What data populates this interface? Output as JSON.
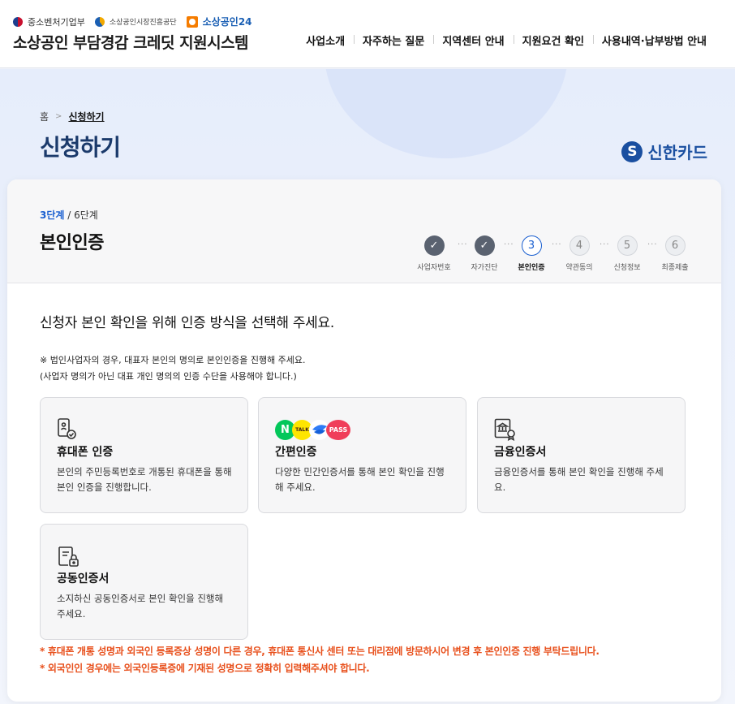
{
  "header": {
    "logo_ministry": "중소벤처기업부",
    "logo_agency": "소상공인시장진흥공단",
    "logo_portal": "소상공인24",
    "site_title": "소상공인 부담경감 크레딧 지원시스템",
    "nav": [
      "사업소개",
      "자주하는 질문",
      "지역센터 안내",
      "지원요건 확인",
      "사용내역·납부방법 안내"
    ]
  },
  "breadcrumb": {
    "home": "홈",
    "current": "신청하기"
  },
  "page_title": "신청하기",
  "partner": {
    "mark": "S",
    "name": "신한카드"
  },
  "step_header": {
    "current": "3단계",
    "total": " / 6단계",
    "title": "본인인증",
    "steps": [
      {
        "num": "✓",
        "label": "사업자번호",
        "state": "done"
      },
      {
        "num": "✓",
        "label": "자가진단",
        "state": "done"
      },
      {
        "num": "3",
        "label": "본인인증",
        "state": "active"
      },
      {
        "num": "4",
        "label": "약관동의",
        "state": "todo"
      },
      {
        "num": "5",
        "label": "신청정보",
        "state": "todo"
      },
      {
        "num": "6",
        "label": "최종제출",
        "state": "todo"
      }
    ]
  },
  "instruction": "신청자 본인 확인을 위해 인증 방식을 선택해 주세요.",
  "note_line1": "※ 법인사업자의 경우, 대표자 본인의 명의로 본인인증을 진행해 주세요.",
  "note_line2": "(사업자 명의가 아닌 대표 개인 명의의 인증 수단을 사용해야 합니다.)",
  "methods": [
    {
      "title": "휴대폰 인증",
      "desc": "본인의 주민등록번호로 개통된 휴대폰을 통해 본인 인증을 진행합니다.",
      "icon": "phone-check-icon"
    },
    {
      "title": "간편인증",
      "desc": "다양한 민간인증서를 통해 본인 확인을 진행해 주세요.",
      "icon": "easy-auth-icons"
    },
    {
      "title": "금융인증서",
      "desc": "금융인증서를 통해 본인 확인을 진행해 주세요.",
      "icon": "bank-certificate-icon"
    },
    {
      "title": "공동인증서",
      "desc": "소지하신 공동인증서로 본인 확인을 진행해 주세요.",
      "icon": "document-lock-icon"
    }
  ],
  "easy_icon_labels": {
    "naver": "N",
    "kakao": "TALK",
    "pass": "PASS"
  },
  "warnings": [
    "* 휴대폰 개통 성명과 외국인 등록증상 성명이 다른 경우, 휴대폰 통신사 센터 또는 대리점에 방문하시어 변경 후 본인인증 진행 부탁드립니다.",
    "* 외국인인 경우에는 외국인등록증에 기재된 성명으로 정확히 입력해주셔야 합니다."
  ],
  "colors": {
    "accent": "#1a5fd0",
    "title": "#1b3a6b",
    "warning": "#e8501c",
    "partner": "#1a4fa0"
  }
}
